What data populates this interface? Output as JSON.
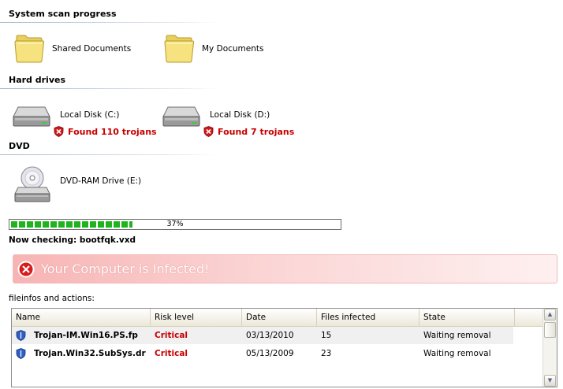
{
  "sections": {
    "scan_title": "System scan progress",
    "hard_drives_title": "Hard drives",
    "dvd_title": "DVD"
  },
  "folders": [
    {
      "label": "Shared Documents",
      "icon": "folder-icon"
    },
    {
      "label": "My Documents",
      "icon": "folder-icon"
    }
  ],
  "drives": [
    {
      "label": "Local Disk (C:)",
      "icon": "hard-drive-icon",
      "warning": "Found 110 trojans"
    },
    {
      "label": "Local Disk (D:)",
      "icon": "hard-drive-icon",
      "warning": "Found 7 trojans"
    }
  ],
  "dvd": {
    "label": "DVD-RAM Drive (E:)",
    "icon": "dvd-drive-icon"
  },
  "progress": {
    "value": 0.37,
    "label": "37%"
  },
  "now_checking": "Now checking: bootfqk.vxd",
  "alert": {
    "text": "Your Computer is Infected!",
    "icon": "error-shield-icon"
  },
  "fileinfos_label": "fileinfos and actions:",
  "table": {
    "columns": [
      "Name",
      "Risk level",
      "Date",
      "Files infected",
      "State"
    ],
    "rows": [
      {
        "name": "Trojan-IM.Win16.PS.fp",
        "risk": "Critical",
        "date": "03/13/2010",
        "files": "15",
        "state": "Waiting removal"
      },
      {
        "name": "Trojan.Win32.SubSys.dr",
        "risk": "Critical",
        "date": "05/13/2009",
        "files": "23",
        "state": "Waiting removal"
      }
    ]
  },
  "colors": {
    "accent_red": "#c80000",
    "progress_green": "#1eb41e",
    "alert_bg": "#f7b4b4"
  }
}
